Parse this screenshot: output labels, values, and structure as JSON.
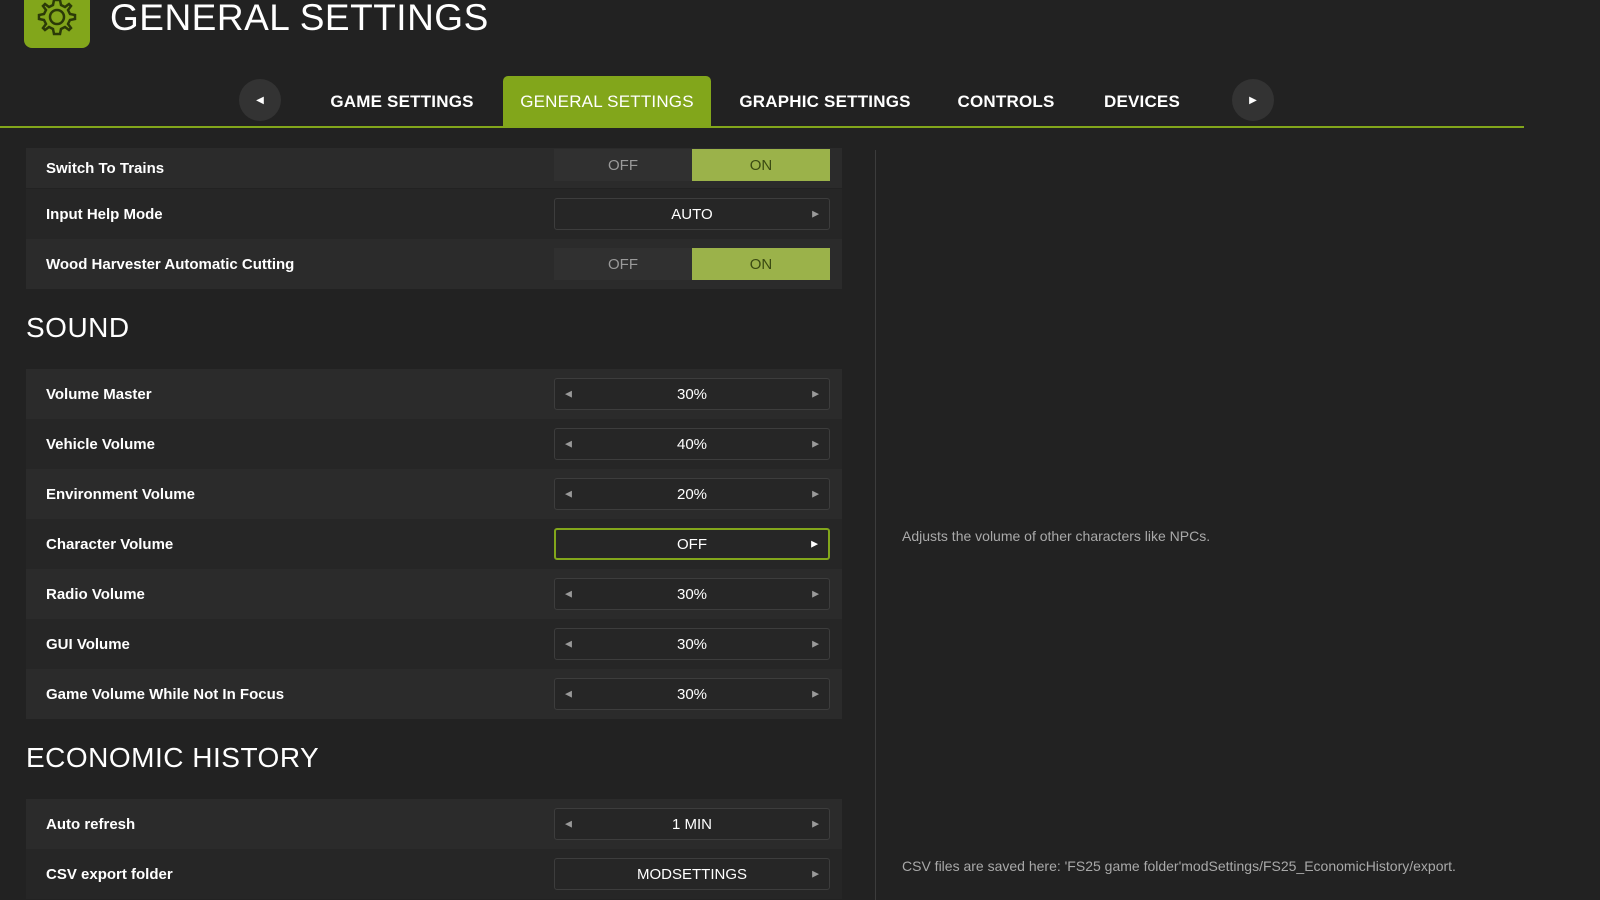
{
  "header": {
    "title": "GENERAL SETTINGS",
    "logo_icon": "gear-icon",
    "accent_color": "#82a61b"
  },
  "tabs": {
    "prev_icon": "chevron-left-icon",
    "next_icon": "chevron-right-icon",
    "items": [
      {
        "label": "GAME SETTINGS",
        "active": false
      },
      {
        "label": "GENERAL SETTINGS",
        "active": true
      },
      {
        "label": "GRAPHIC SETTINGS",
        "active": false
      },
      {
        "label": "CONTROLS",
        "active": false
      },
      {
        "label": "DEVICES",
        "active": false
      }
    ]
  },
  "general": {
    "switch_to_trains": {
      "label": "Switch To Trains",
      "off": "OFF",
      "on": "ON",
      "value": "ON"
    },
    "input_help_mode": {
      "label": "Input Help Mode",
      "value": "AUTO"
    },
    "wood_harvester": {
      "label": "Wood Harvester Automatic Cutting",
      "off": "OFF",
      "on": "ON",
      "value": "ON"
    }
  },
  "sound": {
    "title": "SOUND",
    "volume_master": {
      "label": "Volume Master",
      "value": "30%"
    },
    "vehicle_volume": {
      "label": "Vehicle Volume",
      "value": "40%"
    },
    "environment_volume": {
      "label": "Environment Volume",
      "value": "20%"
    },
    "character_volume": {
      "label": "Character Volume",
      "value": "OFF"
    },
    "radio_volume": {
      "label": "Radio Volume",
      "value": "30%"
    },
    "gui_volume": {
      "label": "GUI Volume",
      "value": "30%"
    },
    "game_volume_unfocused": {
      "label": "Game Volume While Not In Focus",
      "value": "30%"
    }
  },
  "economic_history": {
    "title": "ECONOMIC HISTORY",
    "auto_refresh": {
      "label": "Auto refresh",
      "value": "1 MIN"
    },
    "csv_export_folder": {
      "label": "CSV export folder",
      "value": "MODSETTINGS"
    }
  },
  "help": {
    "character_volume": "Adjusts the volume of other characters like NPCs.",
    "csv_export": "CSV files are saved here: 'FS25 game folder'modSettings/FS25_EconomicHistory/export."
  }
}
